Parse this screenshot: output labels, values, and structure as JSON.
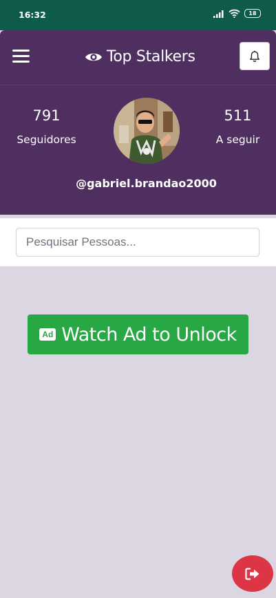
{
  "status_bar": {
    "time": "16:32",
    "battery": "18",
    "icons": [
      "signal-icon",
      "wifi-icon",
      "battery-icon"
    ]
  },
  "header": {
    "title": "Top Stalkers",
    "brand_icon": "eye-icon",
    "menu_icon": "hamburger-menu-icon",
    "notification_icon": "bell-icon",
    "background_color": "#4E2F60"
  },
  "profile": {
    "followers_count": "791",
    "followers_label": "Seguidores",
    "following_count": "511",
    "following_label": "A seguir",
    "username": "@gabriel.brandao2000"
  },
  "search": {
    "placeholder": "Pesquisar Pessoas..."
  },
  "unlock": {
    "badge": "Ad",
    "label": "Watch Ad to Unlock",
    "color": "#28A745"
  },
  "logout": {
    "icon": "sign-out-icon",
    "color": "#DC3545"
  }
}
